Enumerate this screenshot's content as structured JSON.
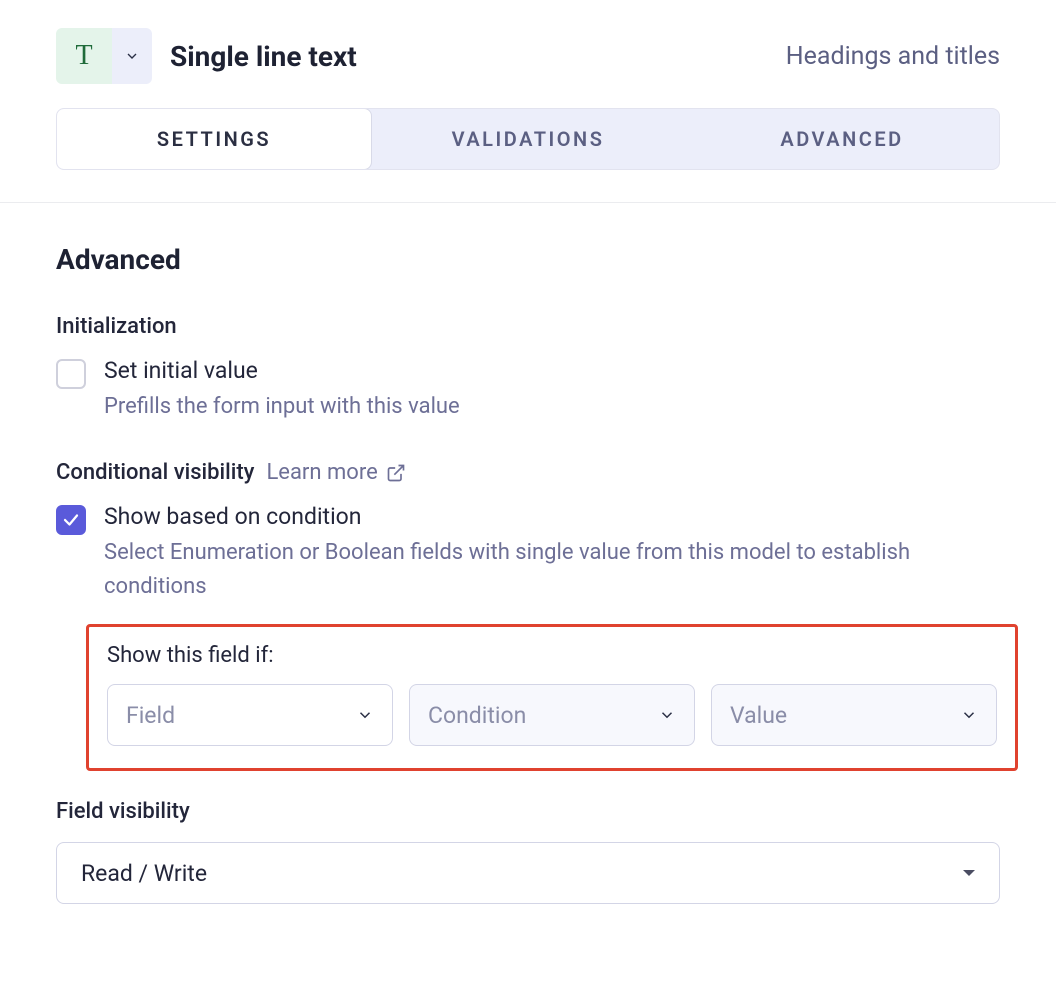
{
  "header": {
    "type_letter": "T",
    "title": "Single line text",
    "breadcrumb": "Headings and titles"
  },
  "tabs": {
    "settings": "SETTINGS",
    "validations": "VALIDATIONS",
    "advanced": "ADVANCED",
    "active": "settings"
  },
  "panel": {
    "heading": "Advanced",
    "initialization": {
      "label": "Initialization",
      "checkbox_title": "Set initial value",
      "checkbox_desc": "Prefills the form input with this value",
      "checked": false
    },
    "conditional": {
      "label": "Conditional visibility",
      "learn_more": "Learn more",
      "checkbox_title": "Show based on condition",
      "checkbox_desc": "Select Enumeration or Boolean fields with single value from this model to establish conditions",
      "checked": true,
      "sub_label": "Show this field if:",
      "field_placeholder": "Field",
      "condition_placeholder": "Condition",
      "value_placeholder": "Value"
    },
    "field_visibility": {
      "label": "Field visibility",
      "value": "Read / Write"
    }
  }
}
